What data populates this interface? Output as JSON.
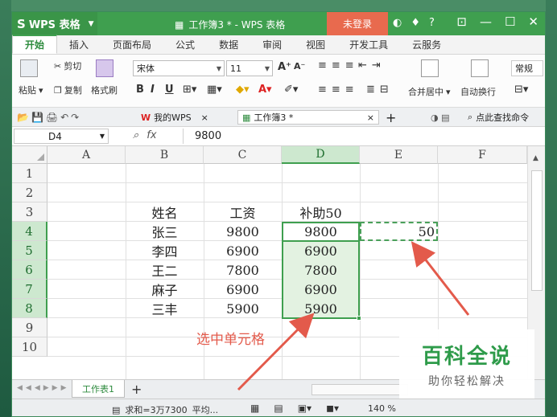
{
  "titlebar": {
    "app_menu": "WPS 表格",
    "doc_title": "工作簿3 * - WPS 表格",
    "login": "未登录",
    "help": "?"
  },
  "menu": [
    "开始",
    "插入",
    "页面布局",
    "公式",
    "数据",
    "审阅",
    "视图",
    "开发工具",
    "云服务"
  ],
  "ribbon": {
    "paste": "粘贴",
    "cut": "剪切",
    "copy": "复制",
    "format_painter": "格式刷",
    "font_name": "宋体",
    "font_size": "11",
    "merge_center": "合并居中",
    "wrap_text": "自动换行",
    "number_format": "常规"
  },
  "doctabs": {
    "tab1": "我的WPS",
    "tab2": "工作簿3 *",
    "search": "点此查找命令"
  },
  "formula_bar": {
    "cell_ref": "D4",
    "fx": "fx",
    "value": "9800"
  },
  "columns": [
    "A",
    "B",
    "C",
    "D",
    "E",
    "F"
  ],
  "rows": [
    "1",
    "2",
    "3",
    "4",
    "5",
    "6",
    "7",
    "8",
    "9",
    "10"
  ],
  "table": {
    "headers": [
      "姓名",
      "工资",
      "补助50"
    ],
    "rows": [
      [
        "张三",
        "9800",
        "9800"
      ],
      [
        "李四",
        "6900",
        "6900"
      ],
      [
        "王二",
        "7800",
        "7800"
      ],
      [
        "麻子",
        "6900",
        "6900"
      ],
      [
        "三丰",
        "5900",
        "5900"
      ]
    ],
    "e4": "50"
  },
  "sheet": {
    "tab": "工作表1",
    "add": "+"
  },
  "status": {
    "sum": "求和=3万7300",
    "avg": "平均...",
    "zoom": "140 %"
  },
  "annotation": "选中单元格",
  "watermark": {
    "title": "百科全说",
    "subtitle": "助你轻松解决"
  },
  "colors": {
    "accent": "#3f9f4f",
    "annotation": "#e35a4b",
    "selection_fill": "#e3f2e1"
  }
}
